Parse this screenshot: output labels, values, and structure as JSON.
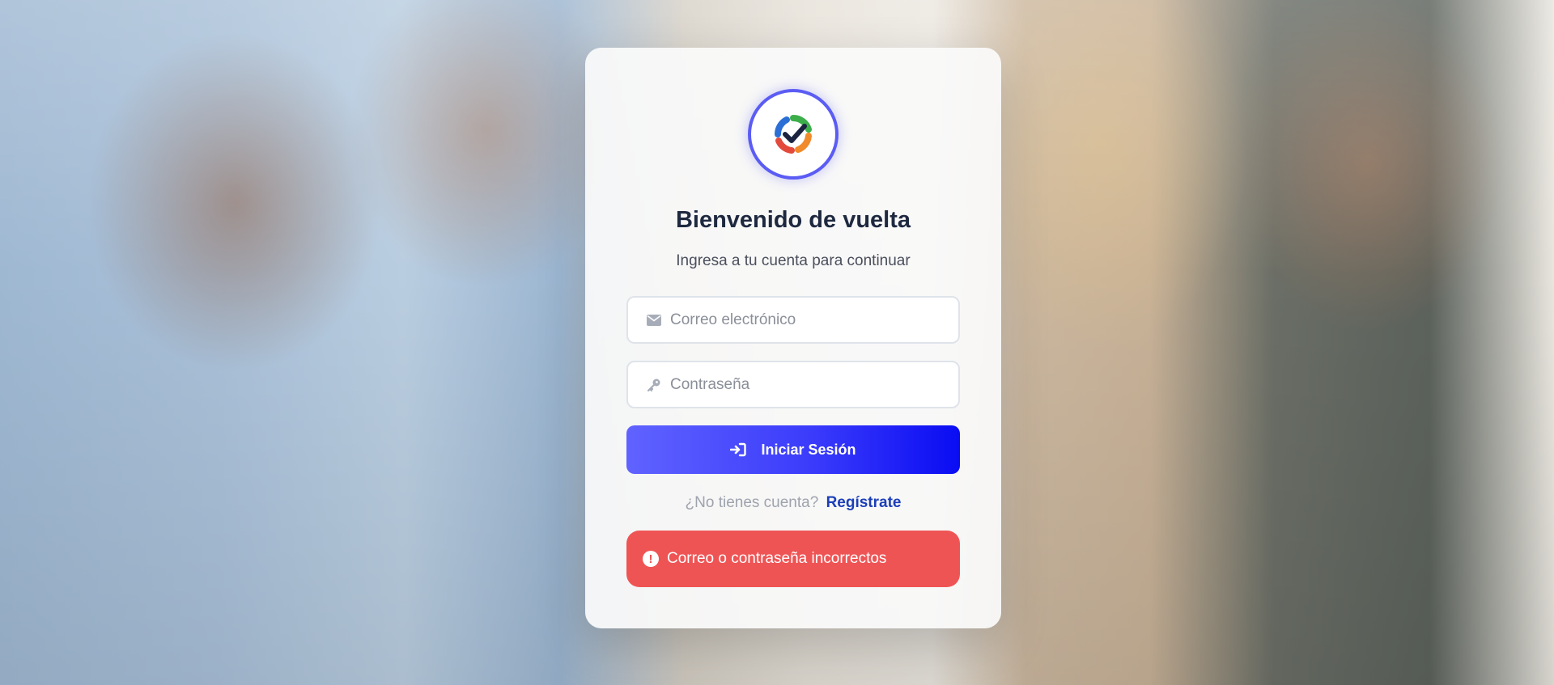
{
  "login": {
    "title": "Bienvenido de vuelta",
    "subtitle": "Ingresa a tu cuenta para continuar",
    "email_placeholder": "Correo electrónico",
    "email_value": "",
    "email_icon": "envelope-icon",
    "password_placeholder": "Contraseña",
    "password_value": "",
    "password_icon": "key-icon",
    "submit_label": "Iniciar Sesión",
    "submit_icon": "sign-in-icon",
    "register_prompt": "¿No tienes cuenta?",
    "register_link": "Regístrate",
    "error_message": "Correo o contraseña incorrectos",
    "error_icon": "exclamation-circle-icon"
  },
  "colors": {
    "accent": "#3b3cfb",
    "link": "#1c3fb8",
    "error": "#ef5455",
    "title": "#1e2940"
  },
  "logo": {
    "icon": "checkmark-logo-icon"
  }
}
